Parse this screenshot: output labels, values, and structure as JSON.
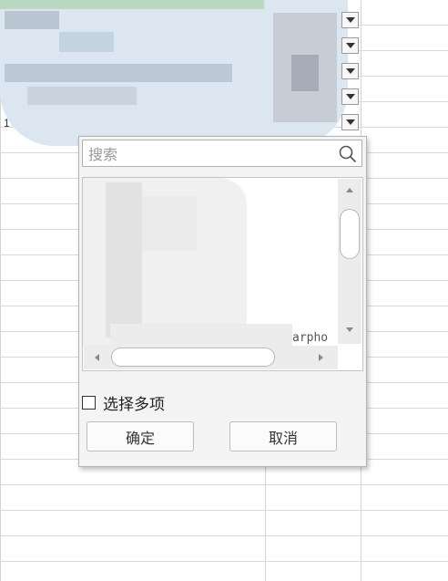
{
  "sheet": {
    "row_label": "1"
  },
  "filter_popup": {
    "search_placeholder": "搜索",
    "search_icon": "search-icon",
    "list_partial_text": "arpho",
    "multi_select_label": "选择多项",
    "multi_select_checked": false,
    "ok_label": "确定",
    "cancel_label": "取消"
  }
}
